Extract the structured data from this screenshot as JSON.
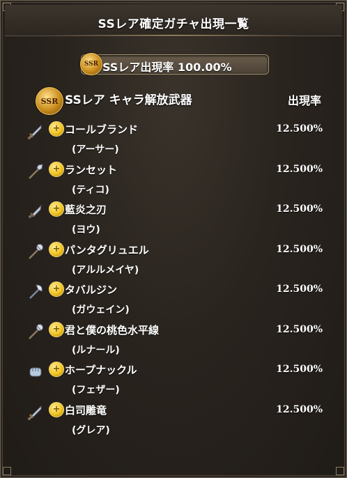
{
  "dialog": {
    "title": "SSレア確定ガチャ出現一覧"
  },
  "rate_summary": {
    "badge": "SSR",
    "label": "SSレア出現率 100.00%"
  },
  "section": {
    "badge": "SSR",
    "title": "SSレア キャラ解放武器",
    "rate_header": "出現率"
  },
  "items": [
    {
      "weapon": "コールブランド",
      "character": "(アーサー)",
      "rate": "12.500%",
      "weapon_type": "sword-icon",
      "element": "light"
    },
    {
      "weapon": "ランセット",
      "character": "(ティコ)",
      "rate": "12.500%",
      "weapon_type": "spear-icon",
      "element": "light"
    },
    {
      "weapon": "藍炎之刃",
      "character": "(ヨウ)",
      "rate": "12.500%",
      "weapon_type": "dagger-icon",
      "element": "light"
    },
    {
      "weapon": "パンタグリュエル",
      "character": "(アルルメイヤ)",
      "rate": "12.500%",
      "weapon_type": "staff-icon",
      "element": "light"
    },
    {
      "weapon": "タバルジン",
      "character": "(ガウェイン)",
      "rate": "12.500%",
      "weapon_type": "axe-icon",
      "element": "light"
    },
    {
      "weapon": "君と僕の桃色水平線",
      "character": "(ルナール)",
      "rate": "12.500%",
      "weapon_type": "staff-icon",
      "element": "light"
    },
    {
      "weapon": "ホープナックル",
      "character": "(フェザー)",
      "rate": "12.500%",
      "weapon_type": "fist-icon",
      "element": "light"
    },
    {
      "weapon": "白司雕竜",
      "character": "(グレア)",
      "rate": "12.500%",
      "weapon_type": "sword-icon",
      "element": "light"
    }
  ],
  "colors": {
    "background": "#2a241f",
    "gold": "#f0c320",
    "pill": "#5a4f41"
  }
}
